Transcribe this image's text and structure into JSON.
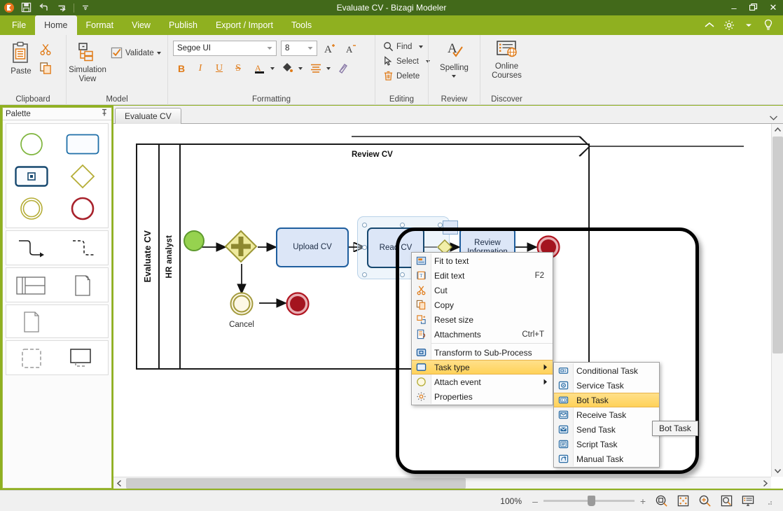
{
  "window": {
    "title": "Evaluate CV - Bizagi Modeler",
    "minimize_label": "–",
    "restore_label": "❐",
    "close_label": "✕"
  },
  "quick_access": {
    "items": [
      {
        "name": "app-logo-icon",
        "label": "Bizagi"
      },
      {
        "name": "save-icon",
        "label": "Save"
      },
      {
        "name": "undo-icon",
        "label": "Undo"
      },
      {
        "name": "redo-icon",
        "label": "Redo"
      },
      {
        "name": "customize-qat-icon",
        "label": "Customize Quick Access Toolbar"
      }
    ]
  },
  "menu_tabs": [
    {
      "label": "File",
      "active": false
    },
    {
      "label": "Home",
      "active": true
    },
    {
      "label": "Format",
      "active": false
    },
    {
      "label": "View",
      "active": false
    },
    {
      "label": "Publish",
      "active": false
    },
    {
      "label": "Export / Import",
      "active": false
    },
    {
      "label": "Tools",
      "active": false
    }
  ],
  "tabstrip_right": [
    {
      "name": "collapse-ribbon-icon",
      "label": "Collapse Ribbon"
    },
    {
      "name": "gear-icon",
      "label": "Options"
    },
    {
      "name": "chevron-down-icon",
      "label": "More"
    },
    {
      "name": "help-lightbulb-icon",
      "label": "Help"
    }
  ],
  "ribbon": {
    "groups": [
      {
        "name": "clipboard",
        "label": "Clipboard",
        "paste_label": "Paste",
        "cut_label": "Cut",
        "copy_label": "Copy"
      },
      {
        "name": "model",
        "label": "Model",
        "simulation_label": "Simulation\nView",
        "simulation_line1": "Simulation",
        "simulation_line2": "View",
        "validate_label": "Validate"
      },
      {
        "name": "formatting",
        "label": "Formatting",
        "font_family": "Segoe UI",
        "font_size": "8",
        "grow_font_label": "Grow Font",
        "shrink_font_label": "Shrink Font",
        "bold_label": "B",
        "italic_label": "I",
        "underline_label": "U",
        "strike_label": "S",
        "font_color_label": "A",
        "fill_color_label": "Fill Color",
        "align_label": "Align",
        "format_painter_label": "Format Painter"
      },
      {
        "name": "editing",
        "label": "Editing",
        "find_label": "Find",
        "select_label": "Select",
        "delete_label": "Delete"
      },
      {
        "name": "review",
        "label": "Review",
        "spelling_label": "Spelling"
      },
      {
        "name": "discover",
        "label": "Discover",
        "online_courses_line1": "Online",
        "online_courses_line2": "Courses"
      }
    ]
  },
  "palette": {
    "title": "Palette",
    "pin_label": "Auto Hide",
    "sections": [
      {
        "name": "events-activities",
        "items": [
          {
            "name": "palette-start-event",
            "label": "Start Event"
          },
          {
            "name": "palette-task",
            "label": "Task"
          },
          {
            "name": "palette-sub-process",
            "label": "Sub-Process"
          },
          {
            "name": "palette-gateway",
            "label": "Gateway"
          },
          {
            "name": "palette-intermediate-event",
            "label": "Intermediate Event"
          },
          {
            "name": "palette-end-event",
            "label": "End Event"
          }
        ]
      },
      {
        "name": "connectors",
        "items": [
          {
            "name": "palette-sequence-flow",
            "label": "Sequence Flow"
          },
          {
            "name": "palette-message-flow",
            "label": "Message Flow"
          }
        ]
      },
      {
        "name": "swimlanes",
        "items": [
          {
            "name": "palette-pool",
            "label": "Pool / Lane"
          },
          {
            "name": "palette-data-object",
            "label": "Data Object"
          }
        ]
      },
      {
        "name": "artifacts",
        "items": [
          {
            "name": "palette-document",
            "label": "Document"
          }
        ]
      },
      {
        "name": "groups-annotations",
        "items": [
          {
            "name": "palette-group",
            "label": "Group"
          },
          {
            "name": "palette-annotation",
            "label": "Annotation"
          }
        ]
      }
    ]
  },
  "doc_tabs": {
    "items": [
      {
        "label": "Evaluate CV",
        "active": true
      }
    ],
    "overflow_label": "Tab list"
  },
  "diagram": {
    "pool_label": "Evaluate CV",
    "lane_label": "HR analyst",
    "process_title": "Review CV",
    "nodes": [
      {
        "name": "start-event",
        "type": "start-event",
        "label": ""
      },
      {
        "name": "parallel-gateway",
        "type": "gateway",
        "label": ""
      },
      {
        "name": "task-upload-cv",
        "type": "task",
        "label": "Upload CV"
      },
      {
        "name": "task-read-cv",
        "type": "task",
        "label": "Read CV",
        "selected": true
      },
      {
        "name": "task-review-information",
        "type": "task",
        "label": "Review Information",
        "label_line1": "Review",
        "label_line2": "Information"
      },
      {
        "name": "end-event",
        "type": "end-event",
        "label": ""
      },
      {
        "name": "intermediate-event-cancel",
        "type": "intermediate-event",
        "label": "Cancel"
      },
      {
        "name": "end-event-cancel",
        "type": "end-event",
        "label": ""
      }
    ]
  },
  "context_menu": {
    "items": [
      {
        "label": "Fit to text",
        "icon": "fit-to-text-icon",
        "accel": "",
        "submenu": false
      },
      {
        "label": "Edit text",
        "icon": "edit-text-icon",
        "accel": "F2",
        "submenu": false
      },
      {
        "label": "Cut",
        "icon": "cut-icon",
        "accel": "",
        "submenu": false
      },
      {
        "label": "Copy",
        "icon": "copy-icon",
        "accel": "",
        "submenu": false
      },
      {
        "label": "Reset size",
        "icon": "reset-size-icon",
        "accel": "",
        "submenu": false
      },
      {
        "label": "Attachments",
        "icon": "attachments-icon",
        "accel": "Ctrl+T",
        "submenu": false
      },
      {
        "label": "Transform to Sub-Process",
        "icon": "sub-process-icon",
        "accel": "",
        "submenu": false,
        "sep_before": true
      },
      {
        "label": "Task type",
        "icon": "task-type-icon",
        "accel": "",
        "submenu": true,
        "highlighted": true
      },
      {
        "label": "Attach event",
        "icon": "attach-event-icon",
        "accel": "",
        "submenu": true
      },
      {
        "label": "Properties",
        "icon": "properties-gear-icon",
        "accel": "",
        "submenu": false
      }
    ]
  },
  "task_type_submenu": {
    "items": [
      {
        "label": "Conditional Task",
        "icon": "conditional-task-icon"
      },
      {
        "label": "Service Task",
        "icon": "service-task-icon"
      },
      {
        "label": "Bot Task",
        "icon": "bot-task-icon",
        "highlighted": true
      },
      {
        "label": "Receive Task",
        "icon": "receive-task-icon"
      },
      {
        "label": "Send Task",
        "icon": "send-task-icon"
      },
      {
        "label": "Script Task",
        "icon": "script-task-icon"
      },
      {
        "label": "Manual Task",
        "icon": "manual-task-icon"
      }
    ]
  },
  "tooltip": {
    "text": "Bot Task"
  },
  "statusbar": {
    "zoom_level": "100%",
    "zoom_out_label": "–",
    "zoom_in_label": "+",
    "icons": [
      {
        "name": "zoom-to-selection-icon",
        "label": "Zoom to selection"
      },
      {
        "name": "fit-to-page-icon",
        "label": "Fit to page"
      },
      {
        "name": "zoom-in-tool-icon",
        "label": "Zoom in"
      },
      {
        "name": "zoom-region-icon",
        "label": "Zoom region"
      },
      {
        "name": "presentation-view-icon",
        "label": "Presentation view"
      }
    ]
  },
  "colors": {
    "title_bar": "#42691a",
    "ribbon_tabs": "#8fb020",
    "accent_orange": "#e07b18",
    "task_fill": "#dce6f7",
    "task_border": "#1f5e9e",
    "start_event": "#8ccd4c",
    "end_event": "#b01520",
    "gateway": "#d9d56a",
    "highlight": "#ffd259"
  }
}
